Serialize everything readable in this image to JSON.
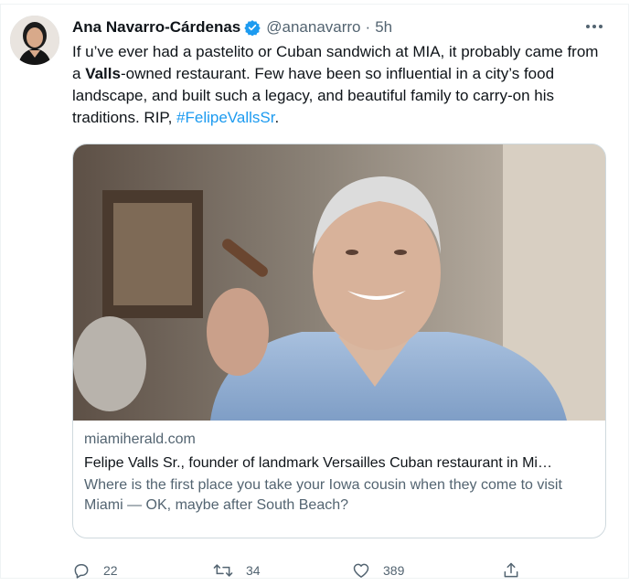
{
  "tweet": {
    "author": {
      "name": "Ana Navarro-Cárdenas",
      "handle": "@ananavarro",
      "separator": "·",
      "time": "5h",
      "verified": true
    },
    "text": {
      "part1": "If u’ve ever had a pastelito or Cuban sandwich at MIA, it probably came from a ",
      "bold": "Valls",
      "part2": "-owned restaurant. Few have been so influential in a city’s food landscape, and built such a legacy, and beautiful family to carry-on his traditions. RIP, ",
      "hashtag": "#FelipeVallsSr",
      "end": "."
    },
    "card": {
      "domain": "miamiherald.com",
      "title": "Felipe Valls Sr., founder of landmark Versailles Cuban restaurant in Mi…",
      "description": "Where is the first place you take your Iowa cousin when they come to visit Miami — OK, maybe after South Beach?"
    },
    "actions": {
      "replies": "22",
      "retweets": "34",
      "likes": "389"
    }
  },
  "colors": {
    "accent": "#1d9bf0",
    "secondary_text": "#536471",
    "border": "#cfd9de"
  },
  "icons": [
    "more-icon",
    "verified-badge-icon",
    "reply-icon",
    "retweet-icon",
    "like-icon",
    "share-icon"
  ]
}
